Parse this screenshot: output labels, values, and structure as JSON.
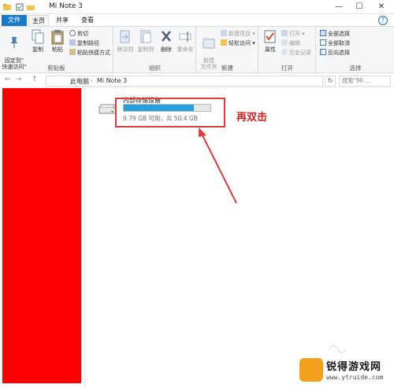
{
  "window": {
    "title": "Mi Note 3",
    "min_glyph": "—",
    "max_glyph": "☐",
    "close_glyph": "✕"
  },
  "tabs": {
    "file": "文件",
    "home": "主页",
    "share": "共享",
    "view": "查看",
    "help_glyph": "?"
  },
  "ribbon": {
    "clipboard": {
      "label": "剪贴板",
      "pin": "固定到\"\n快速访问\"",
      "copy": "复制",
      "paste": "粘贴",
      "cut": "剪切",
      "copy_path": "复制路径",
      "paste_shortcut": "粘贴快捷方式"
    },
    "organize": {
      "label": "组织",
      "move_to": "移动到",
      "copy_to": "复制到",
      "delete": "删除",
      "rename": "重命名"
    },
    "new": {
      "label": "新建",
      "new_folder": "新建\n文件夹",
      "new_item": "新建项目 ▾",
      "easy_access": "轻松访问 ▾"
    },
    "open": {
      "label": "打开",
      "properties": "属性",
      "open": "打开 ▾",
      "edit": "编辑",
      "history": "历史记录"
    },
    "select": {
      "label": "选择",
      "select_all": "全部选择",
      "select_none": "全部取消",
      "invert": "反向选择"
    }
  },
  "address": {
    "back": "←",
    "forward": "→",
    "up": "↑",
    "crumb_root": "此电脑",
    "crumb_device": "Mi Note 3",
    "refresh": "↻",
    "search_placeholder": "搜索\"Mi ..."
  },
  "drive": {
    "name": "内部存储设备",
    "free_text": "9.79 GB 可用，共 50.4 GB",
    "used_fraction": 0.81
  },
  "annotation": {
    "text": "再双击",
    "color": "#e23b3b"
  },
  "watermark": {
    "title": "锐得游戏网",
    "url": "www.ytruide.com"
  }
}
